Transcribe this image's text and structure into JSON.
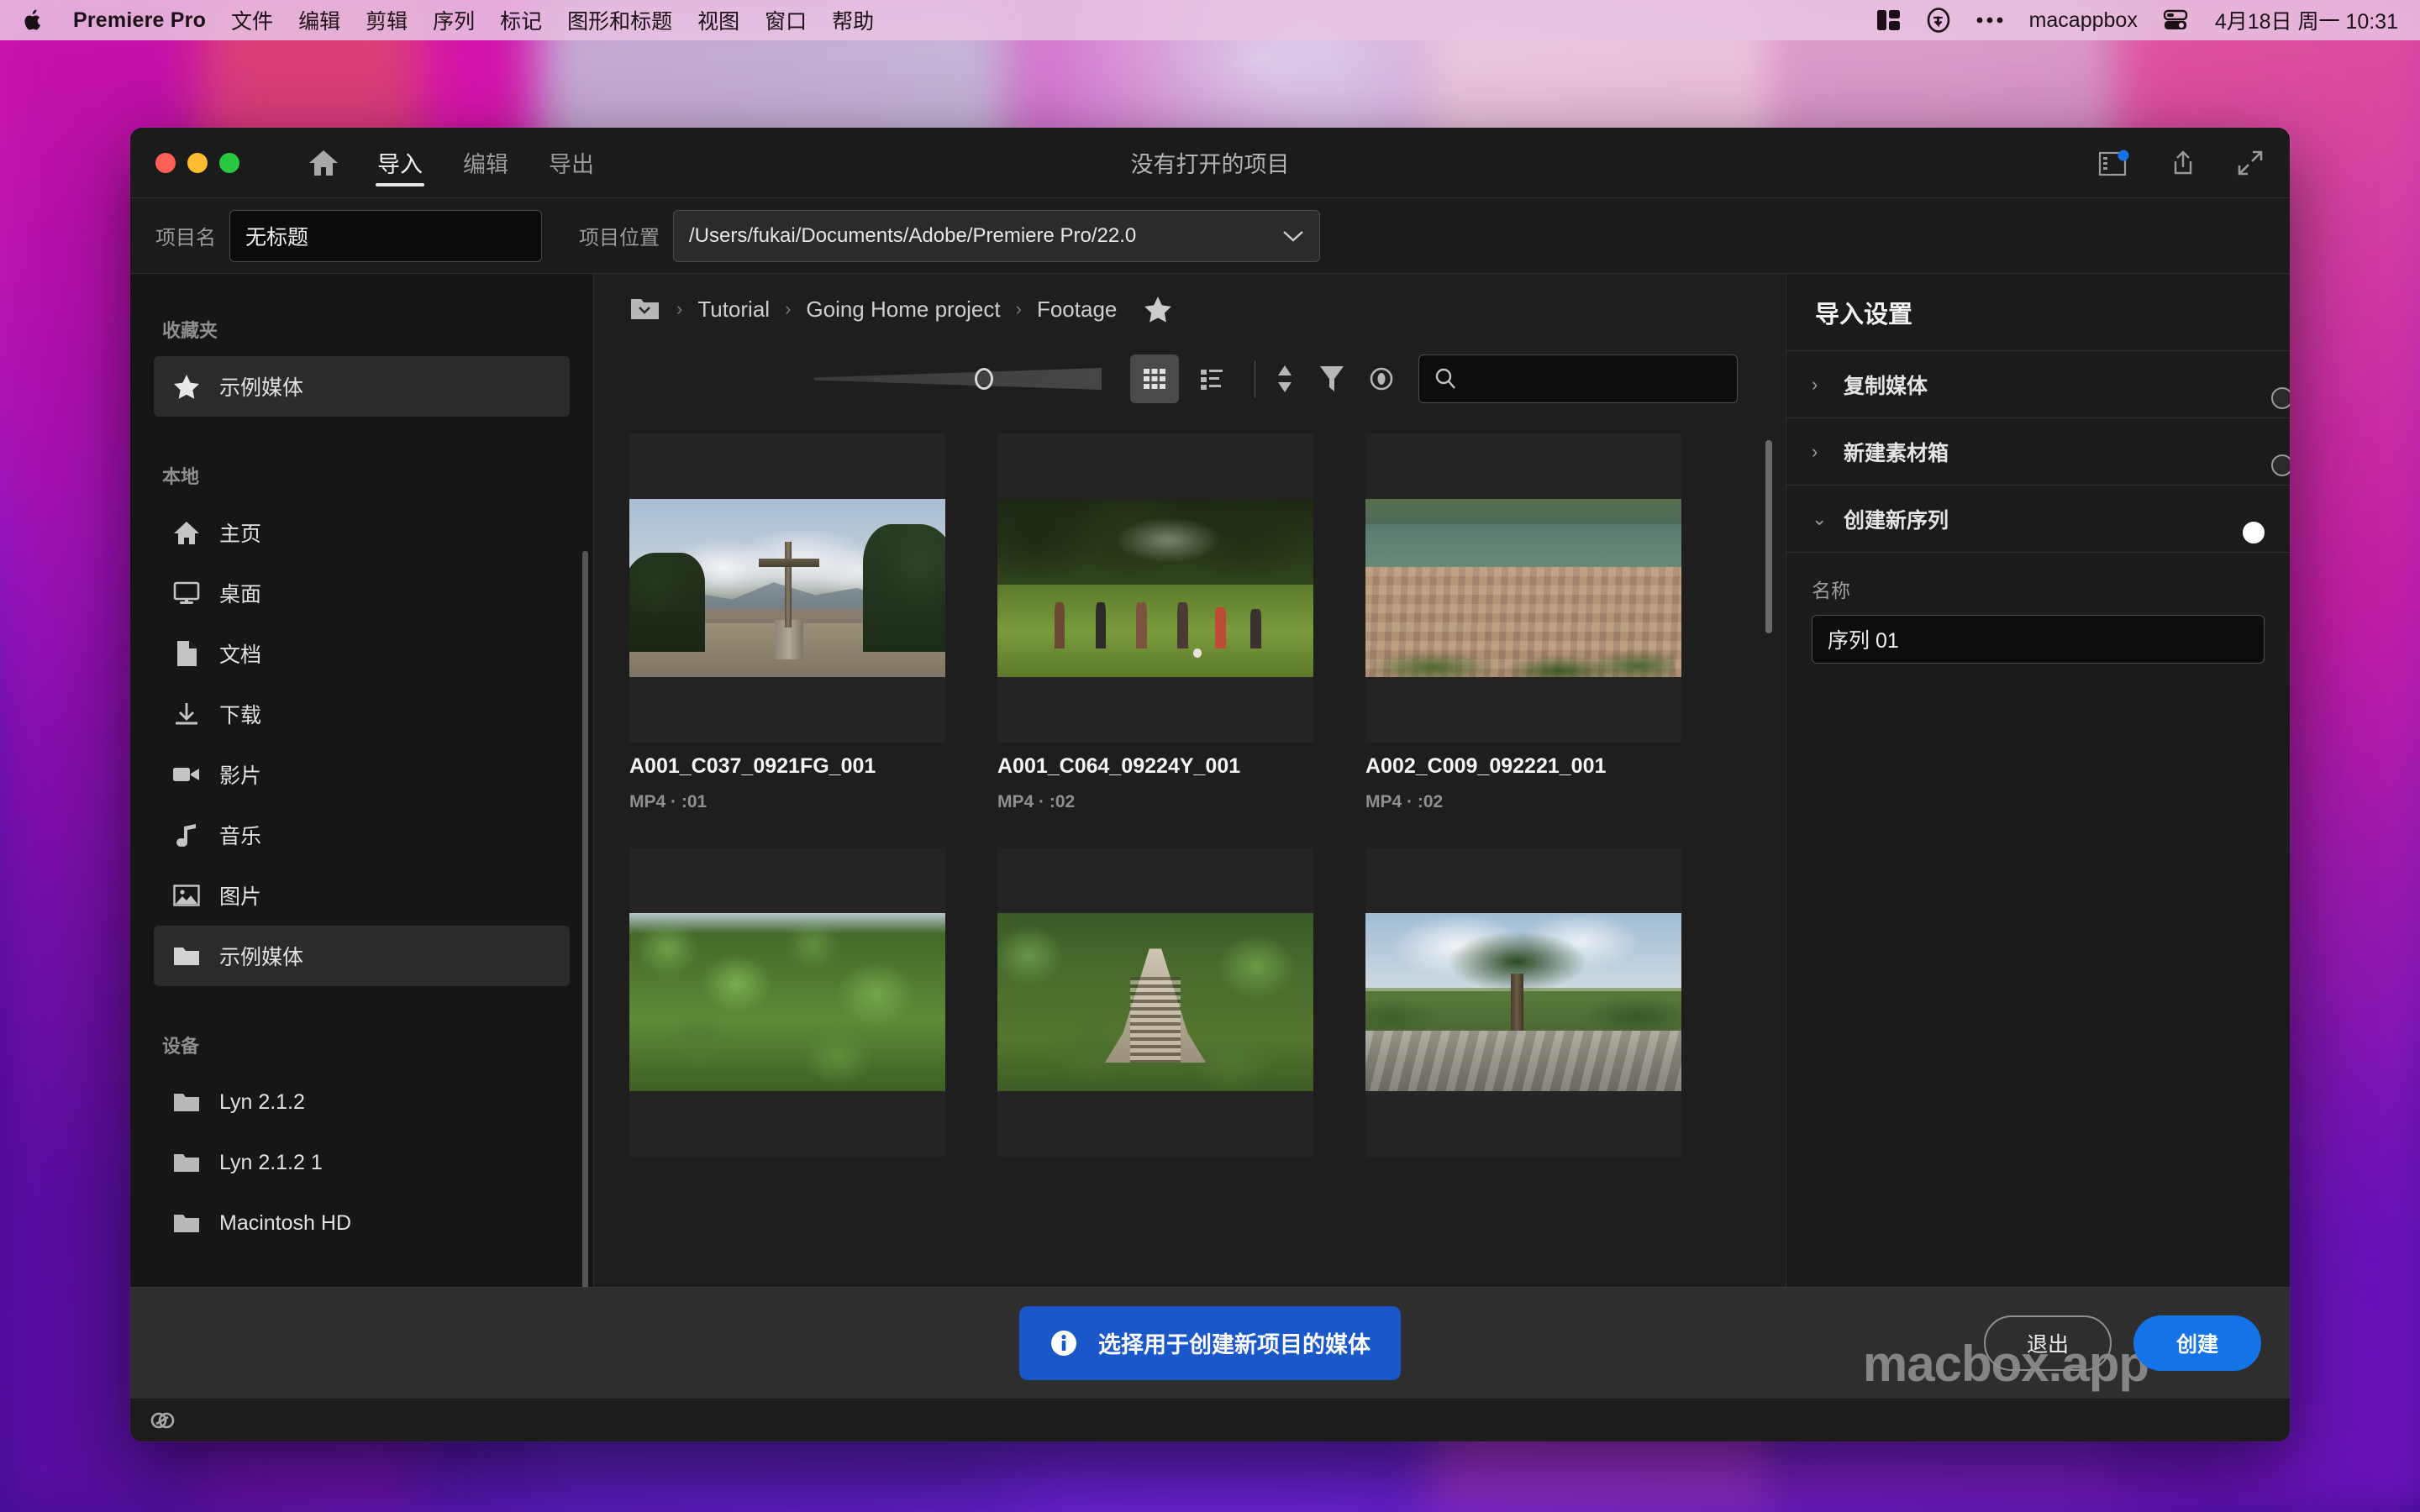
{
  "menubar": {
    "apple_icon": "apple-logo-icon",
    "app_name": "Premiere Pro",
    "items": [
      "文件",
      "编辑",
      "剪辑",
      "序列",
      "标记",
      "图形和标题",
      "视图",
      "窗口",
      "帮助"
    ],
    "right_icons": [
      "control-center-icon",
      "pocket-icon",
      "more-dots-icon",
      "battery-icon"
    ],
    "user": "macappbox",
    "clock": "4月18日 周一  10:31"
  },
  "window": {
    "title": "没有打开的项目",
    "nav": {
      "home_icon": "home-icon",
      "tabs": [
        {
          "label": "导入",
          "active": true
        },
        {
          "label": "编辑",
          "active": false
        },
        {
          "label": "导出",
          "active": false
        }
      ]
    },
    "title_actions": [
      "workspaces-icon",
      "share-icon",
      "fullscreen-icon"
    ]
  },
  "project_row": {
    "name_label": "项目名",
    "name_value": "无标题",
    "name_placeholder": "无标题",
    "location_label": "项目位置",
    "location_value": "/Users/fukai/Documents/Adobe/Premiere Pro/22.0",
    "location_chevron": "chevron-down-icon"
  },
  "sidebar": {
    "sections": [
      {
        "heading": "收藏夹",
        "items": [
          {
            "label": "示例媒体",
            "icon": "star-icon",
            "selected": true
          }
        ]
      },
      {
        "heading": "本地",
        "items": [
          {
            "label": "主页",
            "icon": "home-icon",
            "selected": false
          },
          {
            "label": "桌面",
            "icon": "desktop-icon",
            "selected": false
          },
          {
            "label": "文档",
            "icon": "document-icon",
            "selected": false
          },
          {
            "label": "下载",
            "icon": "download-icon",
            "selected": false
          },
          {
            "label": "影片",
            "icon": "video-camera-icon",
            "selected": false
          },
          {
            "label": "音乐",
            "icon": "music-note-icon",
            "selected": false
          },
          {
            "label": "图片",
            "icon": "image-icon",
            "selected": false
          },
          {
            "label": "示例媒体",
            "icon": "folder-icon",
            "selected": true
          }
        ]
      },
      {
        "heading": "设备",
        "items": [
          {
            "label": "Lyn 2.1.2",
            "icon": "folder-icon",
            "selected": false
          },
          {
            "label": "Lyn 2.1.2 1",
            "icon": "folder-icon",
            "selected": false
          },
          {
            "label": "Macintosh HD",
            "icon": "folder-icon",
            "selected": false
          }
        ]
      }
    ]
  },
  "browser": {
    "breadcrumb": {
      "folder_icon": "folder-dropdown-icon",
      "crumbs": [
        "Tutorial",
        "Going Home project",
        "Footage"
      ],
      "separator": "›",
      "favorite_icon": "star-icon"
    },
    "toolbar": {
      "zoom_slider_value": 59,
      "grid_view_icon": "grid-view-icon",
      "list_view_icon": "list-view-icon",
      "sort_icon": "sort-icon",
      "filter_icon": "filter-icon",
      "preview_icon": "eye-icon",
      "search_icon": "search-icon",
      "search_value": "",
      "search_placeholder": ""
    },
    "items": [
      {
        "name": "A001_C037_0921FG_001",
        "meta": "MP4 · :01",
        "scene": "sc1"
      },
      {
        "name": "A001_C064_09224Y_001",
        "meta": "MP4 · :02",
        "scene": "sc2"
      },
      {
        "name": "A002_C009_092221_001",
        "meta": "MP4 · :02",
        "scene": "sc3"
      },
      {
        "name": "",
        "meta": "",
        "scene": "sc4"
      },
      {
        "name": "",
        "meta": "",
        "scene": "sc5"
      },
      {
        "name": "",
        "meta": "",
        "scene": "sc6"
      }
    ]
  },
  "import_settings": {
    "title": "导入设置",
    "rows": [
      {
        "label": "复制媒体",
        "chevron": "›",
        "toggle_on": false
      },
      {
        "label": "新建素材箱",
        "chevron": "›",
        "toggle_on": false
      },
      {
        "label": "创建新序列",
        "chevron": "⌄",
        "toggle_on": true
      }
    ],
    "sequence_name_label": "名称",
    "sequence_name_value": "序列 01",
    "sequence_name_placeholder": "序列 01"
  },
  "footer": {
    "info_icon": "info-icon",
    "select_media_label": "选择用于创建新项目的媒体",
    "quit_label": "退出",
    "create_label": "创建",
    "watermark": "macbox.app"
  },
  "statusbar": {
    "cc_icon": "creative-cloud-icon"
  },
  "colors": {
    "accent_blue": "#1473e6",
    "primary_button": "#1a57c8",
    "window_bg": "#1e1e1e",
    "panel_bg": "#1b1b1b",
    "sidebar_bg": "#161616",
    "footer_bg": "#2e2e2e",
    "selected_row": "#2b2b2b"
  }
}
